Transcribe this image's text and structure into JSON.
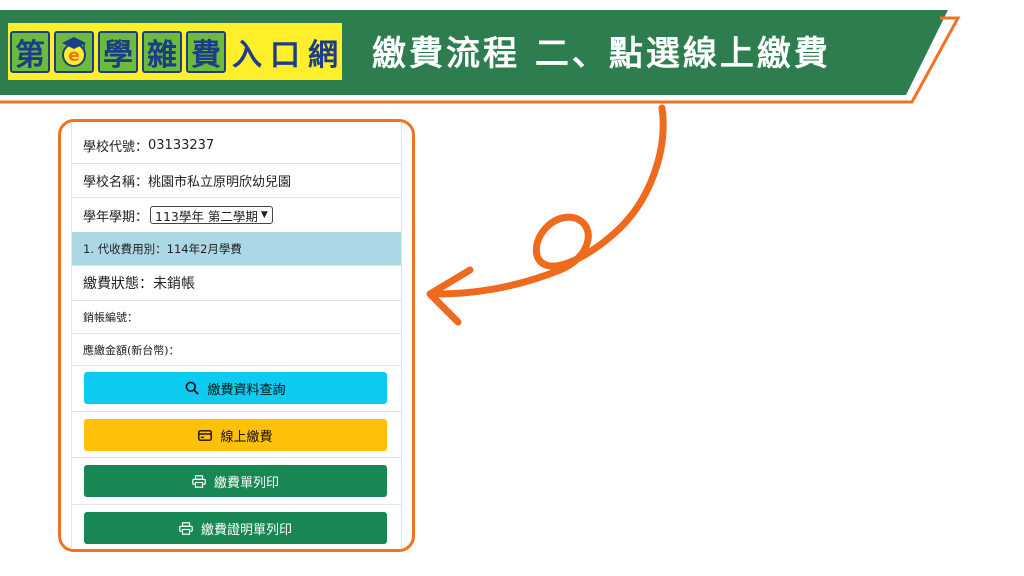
{
  "banner": {
    "logo_chars": [
      "第",
      "學",
      "雜",
      "費",
      "入",
      "口",
      "網"
    ],
    "title": "繳費流程  二、點選線上繳費",
    "colors": {
      "band": "#2e7d4f",
      "outline": "#f07324",
      "logo_bg": "#ffef2a"
    }
  },
  "panel": {
    "school_code_label": "學校代號：",
    "school_code": "03133237",
    "school_name_label": "學校名稱：",
    "school_name": "桃園市私立原明欣幼兒園",
    "term_label": "學年學期：",
    "term_selected": "113學年 第二學期",
    "fee_category": "1. 代收費用別：114年2月學費",
    "status_label": "繳費狀態：",
    "status_value": "未銷帳",
    "writeoff_label": "銷帳編號：",
    "amount_label": "應繳金額(新台幣)：",
    "buttons": {
      "query": "繳費資料查詢",
      "pay_online": "線上繳費",
      "print_bill": "繳費單列印",
      "print_receipt": "繳費證明單列印"
    }
  },
  "annotation": {
    "arrow_color": "#f06a1e"
  }
}
